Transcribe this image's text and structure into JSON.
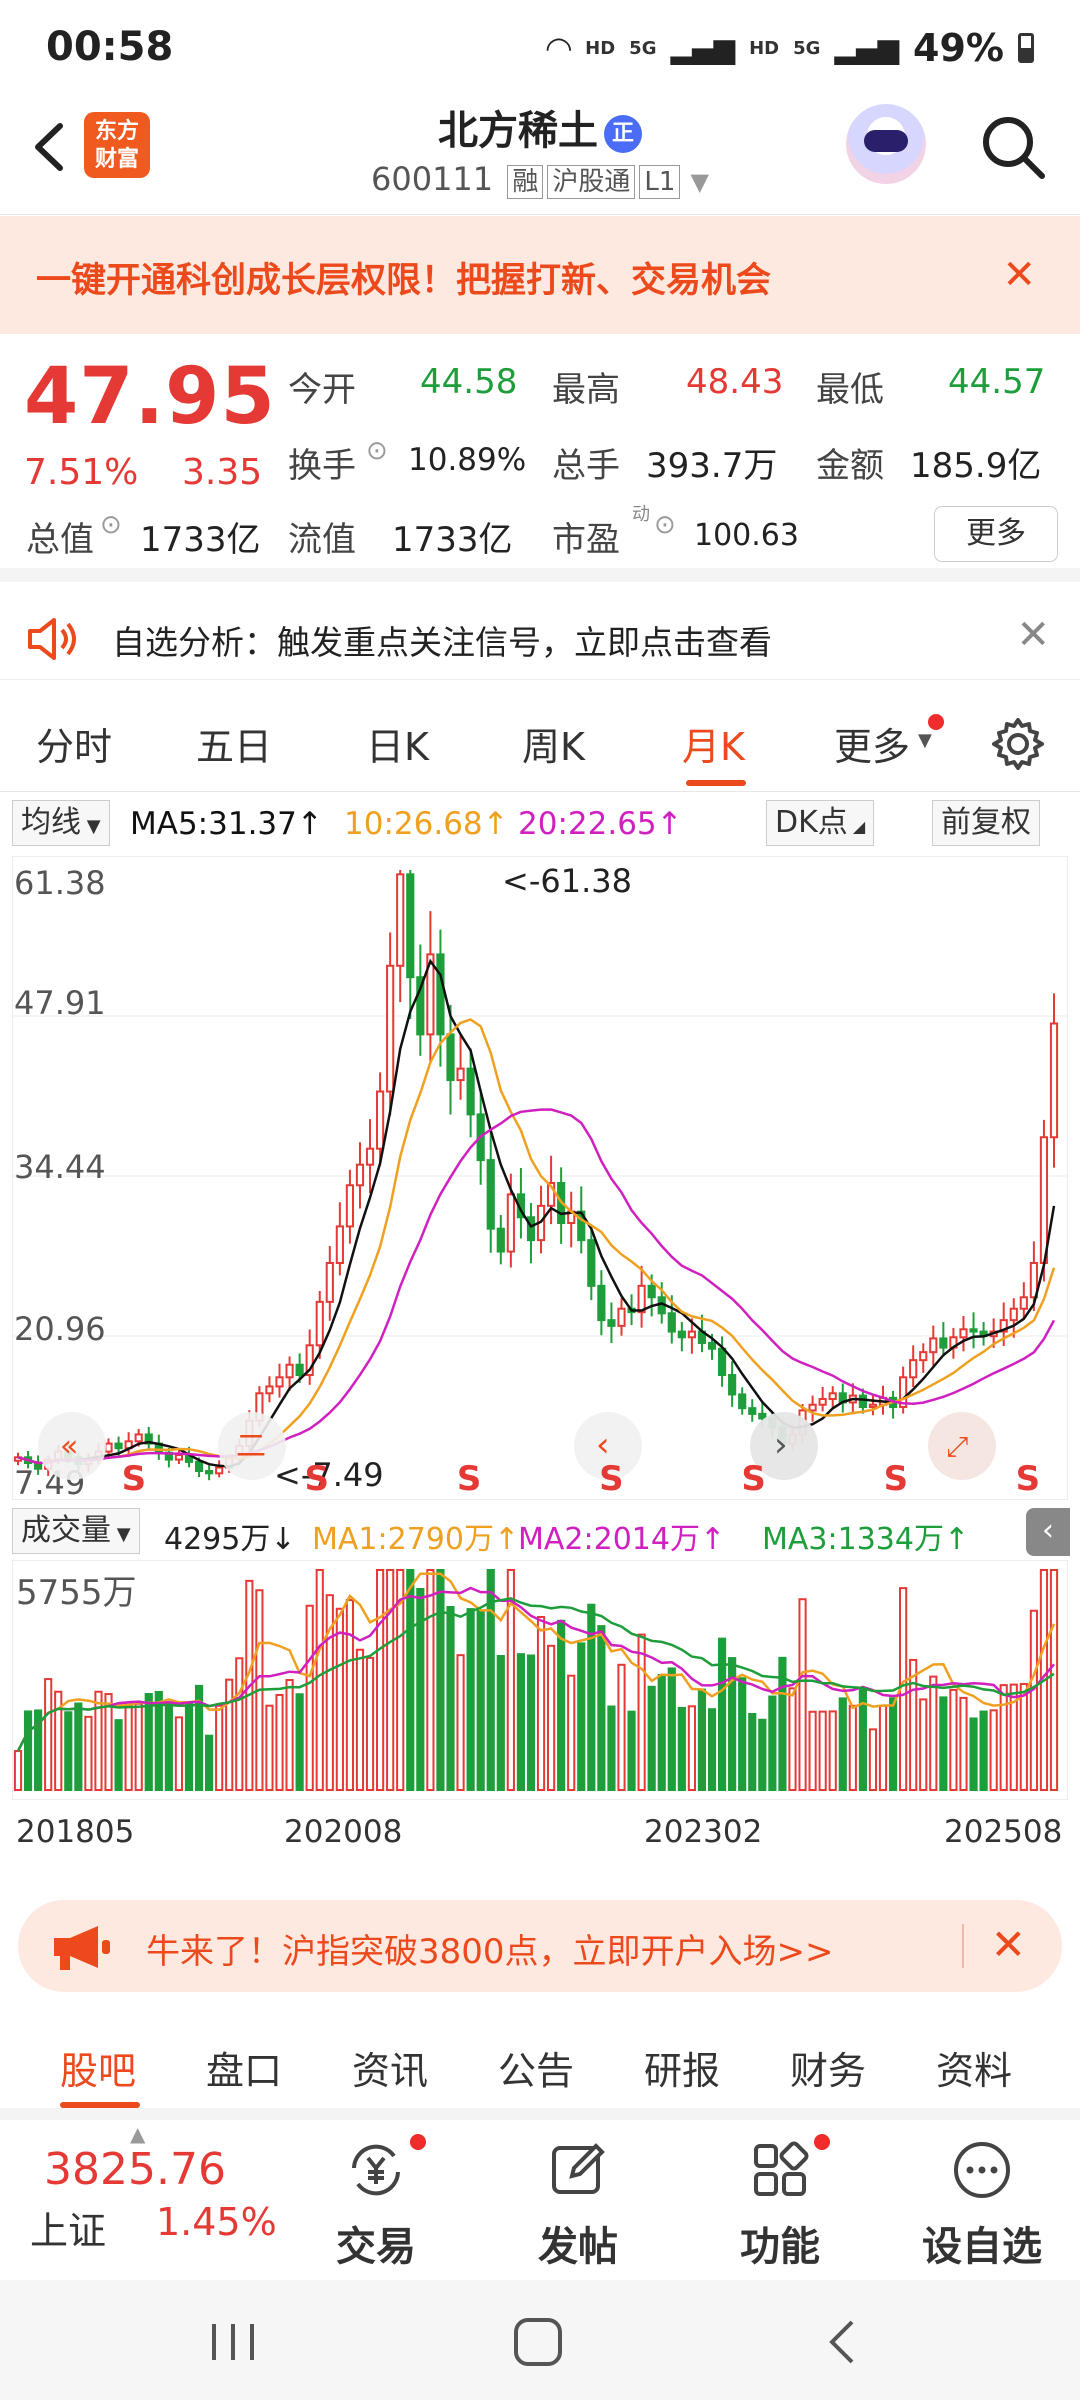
{
  "status_bar": {
    "time": "00:58",
    "network1": "HD",
    "network2": "5G",
    "network3": "HD",
    "network4": "5G",
    "battery": "49%"
  },
  "header": {
    "logo_line1": "东方",
    "logo_line2": "财富",
    "stock_name": "北方稀土",
    "name_badge": "正",
    "code": "600111",
    "tags": [
      "融",
      "沪股通",
      "L1"
    ]
  },
  "promo": {
    "text": "一键开通科创成长层权限！把握打新、交易机会",
    "close": "✕"
  },
  "quote": {
    "price": "47.95",
    "change_pct": "7.51%",
    "change": "3.35",
    "open_label": "今开",
    "open": "44.58",
    "high_label": "最高",
    "high": "48.43",
    "low_label": "最低",
    "low": "44.57",
    "turnover_label": "换手",
    "turnover": "10.89%",
    "volume_label": "总手",
    "volume": "393.7万",
    "amount_label": "金额",
    "amount": "185.9亿",
    "mktcap_label": "总值",
    "mktcap": "1733亿",
    "float_label": "流值",
    "float_cap": "1733亿",
    "pe_label": "市盈",
    "pe_sup": "动",
    "pe": "100.63",
    "more": "更多"
  },
  "signal": {
    "text": "自选分析：触发重点关注信号，立即点击查看",
    "close": "✕"
  },
  "tabs": [
    "分时",
    "五日",
    "日K",
    "周K",
    "月K",
    "更多"
  ],
  "active_tab": "月K",
  "indicators": {
    "ma_select": "均线",
    "ma5": "MA5:31.37",
    "ma10": "10:26.68",
    "ma20": "20:22.65",
    "dk": "DK点",
    "adjust": "前复权"
  },
  "colors": {
    "up": "#e53935",
    "down": "#1e9e3a",
    "ma5": "#111111",
    "ma10": "#f0a020",
    "ma20": "#d020c0",
    "accent": "#ec4a1c"
  },
  "kline_axis": {
    "y1": "61.38",
    "y2": "47.91",
    "y3": "34.44",
    "y4": "20.96",
    "y5": "7.49",
    "max_label": "61.38",
    "min_label": "7.49"
  },
  "volume": {
    "select": "成交量",
    "current": "4295万",
    "ma1": "MA1:2790万",
    "ma2": "MA2:2014万",
    "ma3": "MA3:1334万",
    "max": "5755万"
  },
  "x_labels": [
    "201805",
    "202008",
    "202302",
    "202508"
  ],
  "chart_data": {
    "type": "candlestick",
    "period": "monthly",
    "ylim": [
      7.49,
      61.38
    ],
    "y_ticks": [
      61.38,
      47.91,
      34.44,
      20.96
    ],
    "max_price": 61.38,
    "min_price": 7.49,
    "ma5": 31.37,
    "ma10": 26.68,
    "ma20": 22.65,
    "close_series": [
      10,
      9.5,
      9,
      9.8,
      10.5,
      10,
      9.4,
      9.8,
      10.5,
      11.2,
      10.8,
      11.4,
      12,
      11.2,
      10.4,
      9.8,
      10.2,
      9.6,
      8.8,
      8.6,
      9.1,
      9.9,
      11,
      13.2,
      15.6,
      16.2,
      17,
      18.1,
      17.2,
      19.8,
      23.6,
      27,
      30.2,
      33.8,
      35.6,
      37,
      42,
      53,
      61,
      52,
      47,
      54,
      47,
      43,
      44,
      40,
      36,
      30,
      28,
      33,
      31,
      29,
      32,
      34,
      30.5,
      31.5,
      29,
      25,
      22,
      21.5,
      23,
      22.7,
      25,
      24,
      22.6,
      21,
      20.5,
      21,
      20,
      19.5,
      17.2,
      15.5,
      14.3,
      13.8,
      13.4,
      12.6,
      11.2,
      12,
      14.1,
      14.6,
      15.1,
      15.6,
      14.8,
      15.4,
      14.4,
      14.6,
      15.2,
      14.4,
      17,
      18.5,
      19.2,
      20.4,
      19.6,
      20.5,
      21.2,
      21,
      20.6,
      21,
      22,
      23,
      24,
      27,
      38,
      47.95
    ],
    "volume_max": "5755万",
    "volume_current": "4295万",
    "x_labels": [
      "201805",
      "202008",
      "202302",
      "202508"
    ]
  },
  "chart_overlay": {
    "s_mark": "S",
    "flag_chars": [
      "二",
      "‹",
      "›"
    ]
  },
  "bull_banner": {
    "text": "牛来了！沪指突破3800点，立即开户入场>>",
    "close": "✕"
  },
  "subtabs": [
    "股吧",
    "盘口",
    "资讯",
    "公告",
    "研报",
    "财务",
    "资料"
  ],
  "active_subtab": "股吧",
  "bottom_nav": {
    "index_value": "3825.76",
    "index_name": "上证",
    "index_pct": "1.45%",
    "buttons": [
      "交易",
      "发帖",
      "功能",
      "设自选"
    ]
  }
}
